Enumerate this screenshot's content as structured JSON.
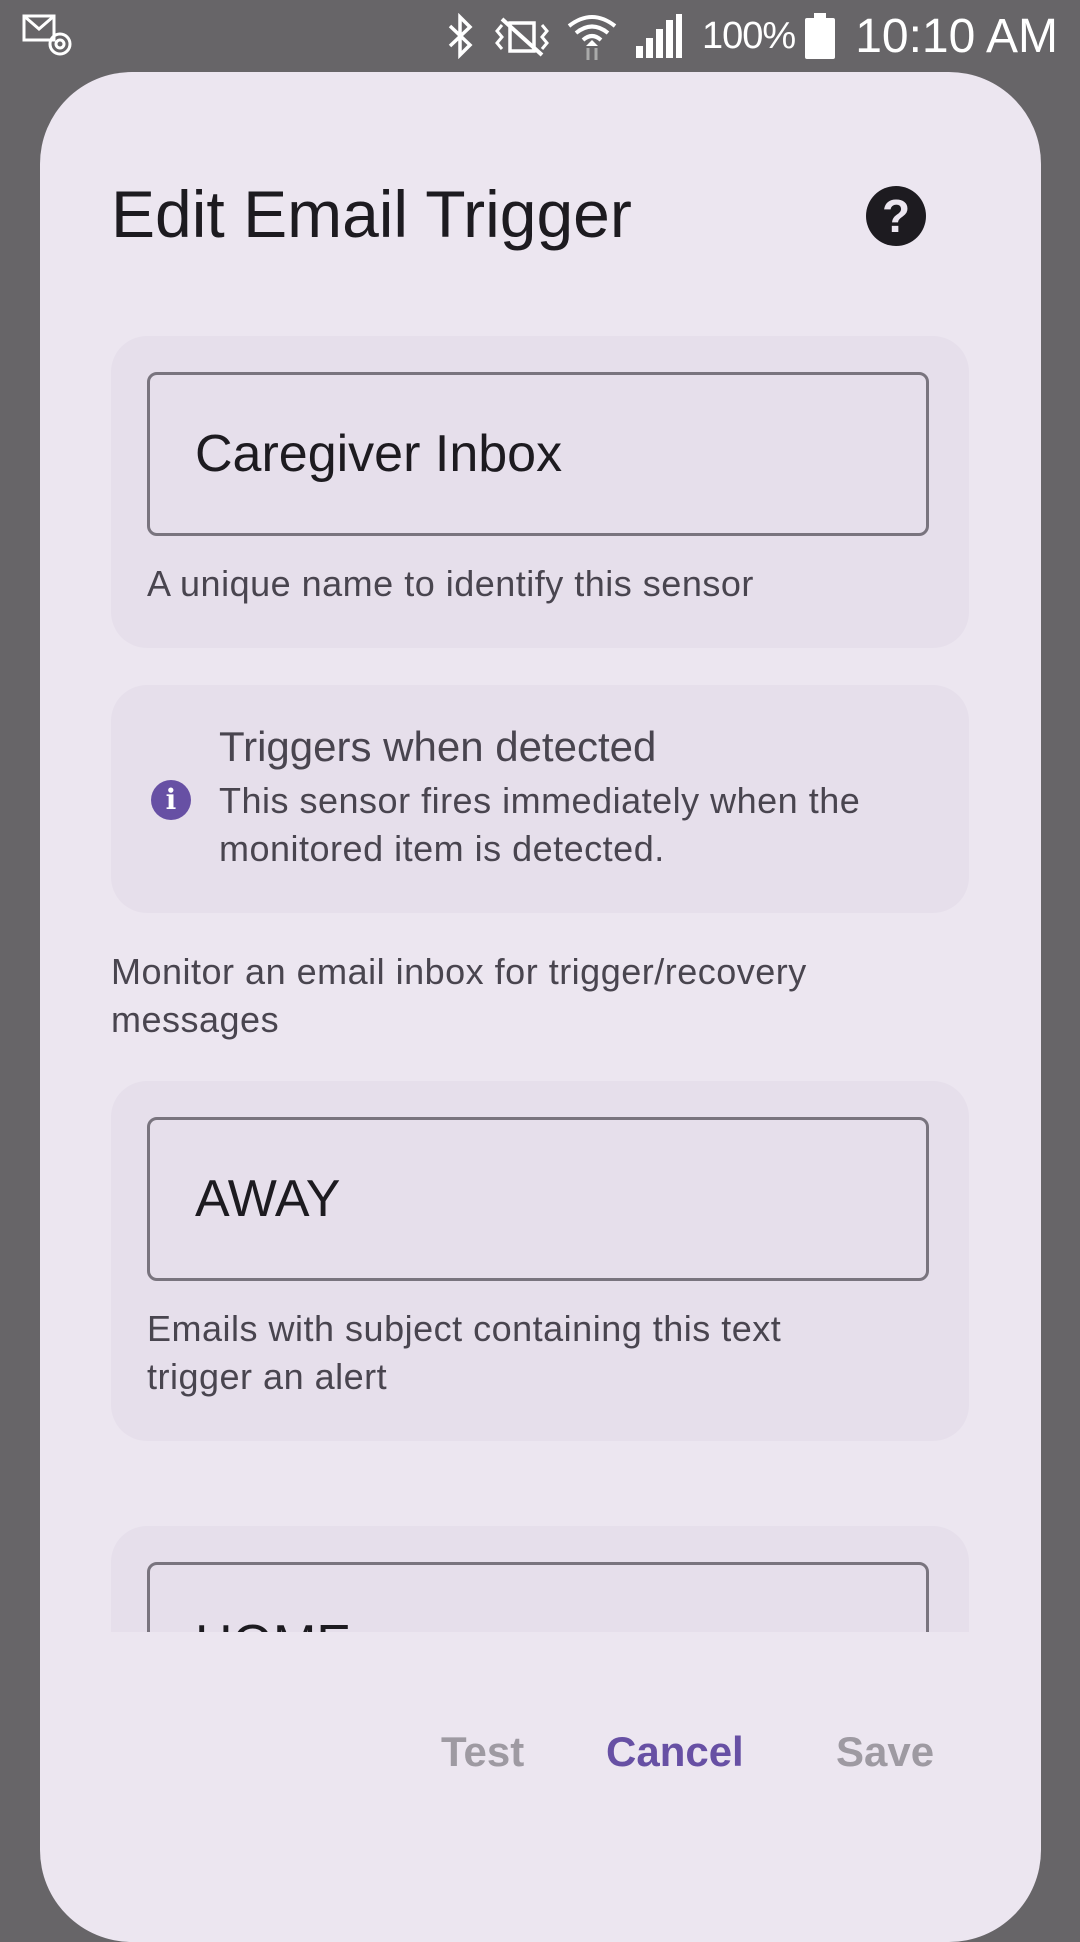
{
  "status_bar": {
    "notification_icon": "email-notification-icon",
    "icons": [
      "bluetooth-icon",
      "mute-vibrate-icon",
      "wifi-icon",
      "signal-icon"
    ],
    "battery_percent": "100%",
    "time": "10:10 AM"
  },
  "dialog": {
    "title": "Edit Email Trigger",
    "help_icon": "help-icon",
    "help_glyph": "?",
    "name_field": {
      "value": "Caregiver Inbox",
      "helper": "A unique name to identify this sensor"
    },
    "info": {
      "icon": "info-icon",
      "icon_glyph": "i",
      "title": "Triggers when detected",
      "body": "This sensor fires immediately when the monitored item is detected."
    },
    "description": "Monitor an email inbox for trigger/recovery messages",
    "trigger_field": {
      "value": "AWAY",
      "helper": "Emails with subject containing this text trigger an alert"
    },
    "recovery_field": {
      "value": "HOME"
    },
    "actions": {
      "test": "Test",
      "cancel": "Cancel",
      "save": "Save"
    }
  },
  "colors": {
    "scrim": "#676568",
    "dialog_bg": "#ece6f0",
    "card_bg": "#e6dfeb",
    "primary": "#6750a4",
    "disabled": "#9e9aa2",
    "outline": "#79747e"
  }
}
